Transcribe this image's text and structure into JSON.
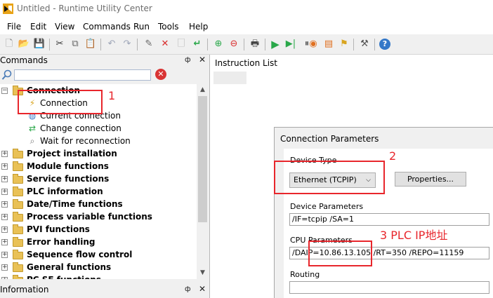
{
  "window": {
    "title": "Untitled - Runtime Utility Center"
  },
  "menu": [
    "File",
    "Edit",
    "View",
    "Commands",
    "Run",
    "Tools",
    "Help"
  ],
  "left_panel": {
    "commands_title": "Commands",
    "pin_glyph": "ᵖ",
    "close_glyph": "✕",
    "search_placeholder": "",
    "tree": [
      {
        "label": "Connection",
        "expanded": true,
        "children": [
          "Connection",
          "Current connection",
          "Change connection",
          "Wait for reconnection"
        ]
      },
      {
        "label": "Project installation"
      },
      {
        "label": "Module functions"
      },
      {
        "label": "Service functions"
      },
      {
        "label": "PLC information"
      },
      {
        "label": "Date/Time functions"
      },
      {
        "label": "Process variable functions"
      },
      {
        "label": "PVI functions"
      },
      {
        "label": "Error handling"
      },
      {
        "label": "Sequence flow control"
      },
      {
        "label": "General functions"
      },
      {
        "label": "PC SE functions"
      }
    ],
    "information_title": "Information"
  },
  "instruction_list": {
    "title": "Instruction List"
  },
  "connection_dialog": {
    "title": "Connection Parameters",
    "device_type_label": "Device Type",
    "device_type_value": "Ethernet (TCPIP)",
    "properties_button": "Properties...",
    "device_params_label": "Device Parameters",
    "device_params_value": "/IF=tcpip /SA=1",
    "cpu_params_label": "CPU Parameters",
    "cpu_params_value": "/DAIP=10.86.13.105 /RT=350 /REPO=11159",
    "routing_label": "Routing",
    "routing_value": ""
  },
  "annotations": {
    "a1": "1",
    "a2": "2",
    "a3": "3 PLC IP地址"
  },
  "colors": {
    "annotation": "#e8262c",
    "folder": "#e9c156",
    "run": "#2aa84a"
  },
  "icons": [
    "new-icon",
    "open-icon",
    "save-icon",
    "cut-icon",
    "copy-icon",
    "paste-icon",
    "undo-icon",
    "redo-icon",
    "edit-icon",
    "delete-icon",
    "clear-icon",
    "insert-icon",
    "add-icon",
    "remove-icon",
    "print-icon",
    "run-icon",
    "step-icon",
    "pause-icon",
    "settings-icon",
    "options-icon",
    "tools-icon",
    "help-icon"
  ]
}
